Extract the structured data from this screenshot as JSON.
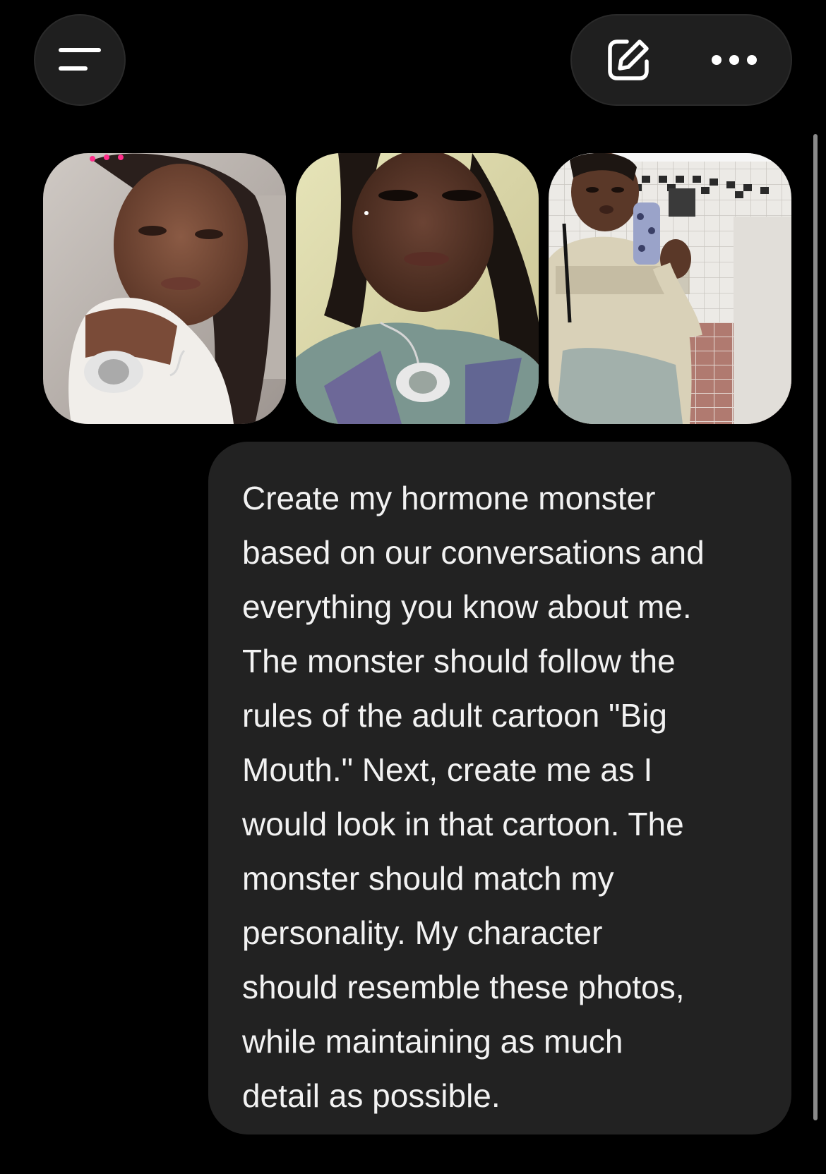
{
  "header": {
    "menu_icon": "menu-icon",
    "edit_icon": "compose-icon",
    "more_icon": "more-horizontal-icon"
  },
  "attachments": [
    {
      "icon": "photo-thumbnail"
    },
    {
      "icon": "photo-thumbnail"
    },
    {
      "icon": "photo-thumbnail"
    }
  ],
  "message": {
    "role": "user",
    "lines": [
      "Create my hormone monster",
      "based on our conversations and",
      "everything you know about me.",
      "The monster should follow the",
      "rules of the adult cartoon \"Big",
      "Mouth.\" Next, create me as I",
      "would look in that cartoon. The",
      "monster should match my",
      "personality. My character",
      "should resemble these photos,",
      "while maintaining as much",
      "detail as possible."
    ]
  },
  "colors": {
    "background": "#000000",
    "button_bg": "#1f1f1f",
    "bubble_bg": "#222222",
    "text": "#f2f2f2",
    "icon": "#ffffff"
  }
}
